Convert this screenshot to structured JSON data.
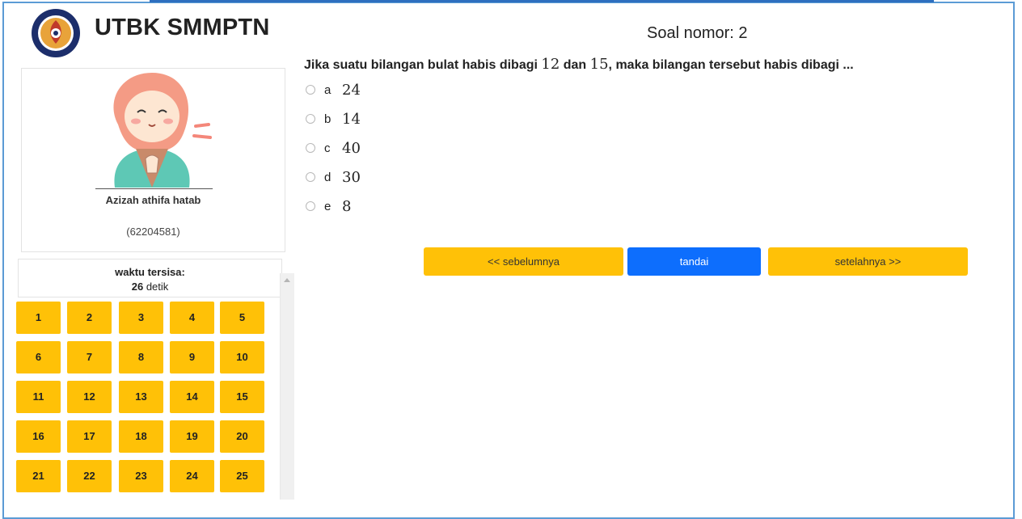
{
  "header": {
    "app_title": "UTBK SMMPTN"
  },
  "profile": {
    "name": "Azizah athifa hatab",
    "id": "(62204581)"
  },
  "timer": {
    "label": "waktu tersisa:",
    "value": "26",
    "unit": "detik"
  },
  "question_numbers": [
    "1",
    "2",
    "3",
    "4",
    "5",
    "6",
    "7",
    "8",
    "9",
    "10",
    "11",
    "12",
    "13",
    "14",
    "15",
    "16",
    "17",
    "18",
    "19",
    "20",
    "21",
    "22",
    "23",
    "24",
    "25"
  ],
  "question": {
    "title": "Soal nomor: 2",
    "text_part1": "Jika suatu bilangan bulat habis dibagi ",
    "num1": "12",
    "text_part2": " dan ",
    "num2": "15",
    "text_part3": ", maka bilangan tersebut habis dibagi ...",
    "options": [
      {
        "letter": "a",
        "value": "24"
      },
      {
        "letter": "b",
        "value": "14"
      },
      {
        "letter": "c",
        "value": "40"
      },
      {
        "letter": "d",
        "value": "30"
      },
      {
        "letter": "e",
        "value": "8"
      }
    ]
  },
  "nav": {
    "prev": "<< sebelumnya",
    "mark": "tandai",
    "next": "setelahnya >>"
  },
  "colors": {
    "yellow": "#ffc107",
    "blue": "#0d6efd",
    "frame": "#5b9bd5"
  }
}
